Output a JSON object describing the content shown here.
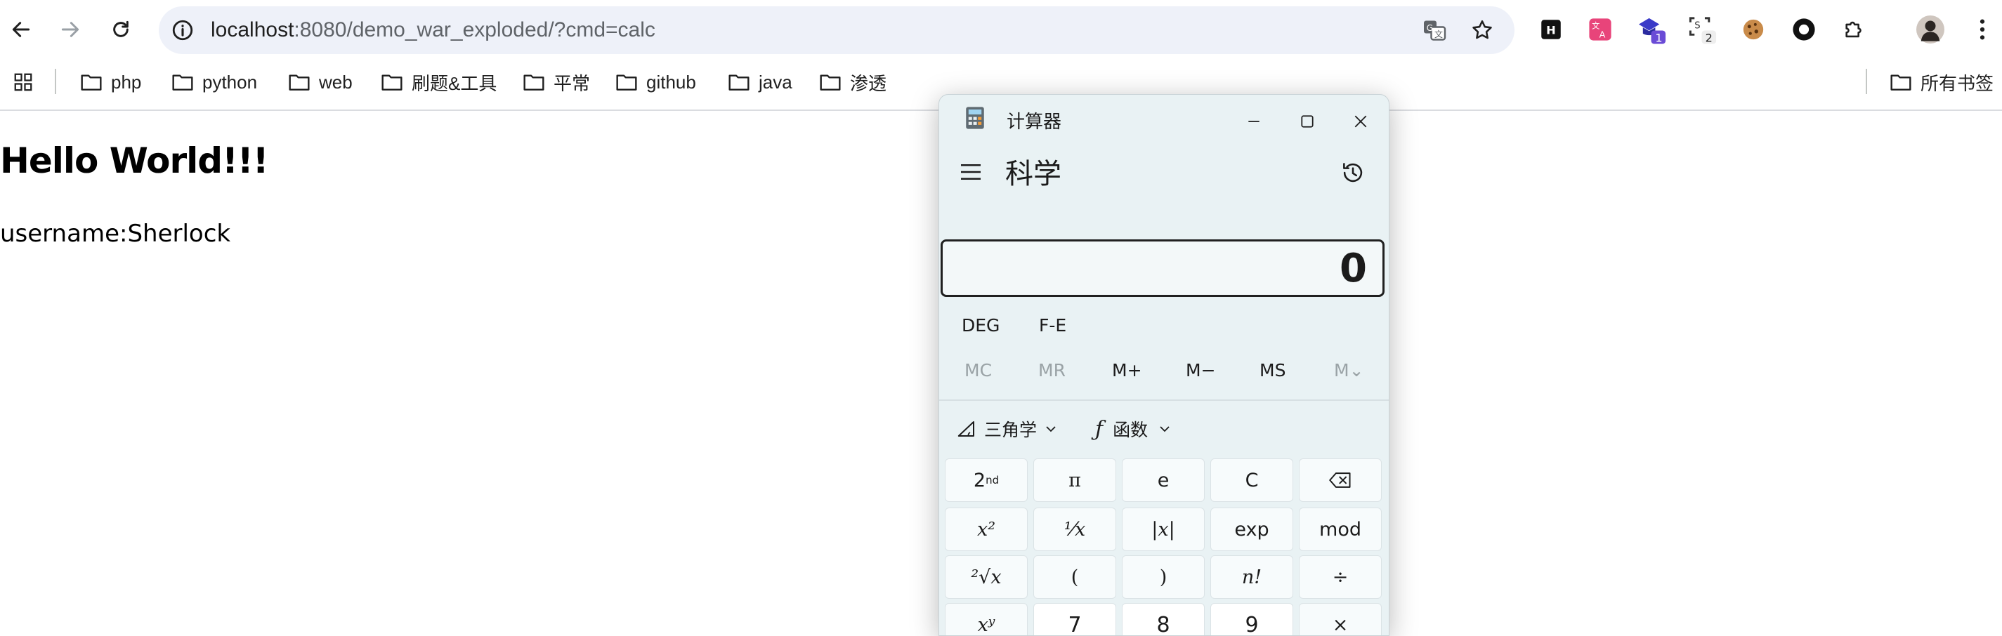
{
  "browser": {
    "url_host": "localhost",
    "url_rest": ":8080/demo_war_exploded/?cmd=calc",
    "extensions": [
      {
        "icon": "hackbar-icon",
        "badge": ""
      },
      {
        "icon": "translate-extension-icon",
        "badge": ""
      },
      {
        "icon": "extension-badge-icon",
        "badge": "1"
      },
      {
        "icon": "screenshot-extension-icon",
        "badge": "2"
      },
      {
        "icon": "cookie-icon",
        "badge": ""
      },
      {
        "icon": "circle-extension-icon",
        "badge": ""
      },
      {
        "icon": "puzzle-icon",
        "badge": ""
      }
    ],
    "bookmarks": [
      "php",
      "python",
      "web",
      "刷题&工具",
      "平常",
      "github",
      "java",
      "渗透"
    ],
    "all_bookmarks_label": "所有书签"
  },
  "page": {
    "heading": "Hello World!!!",
    "text": "username:Sherlock"
  },
  "calculator": {
    "title": "计算器",
    "mode": "科学",
    "display_value": "0",
    "angle_unit": "DEG",
    "fe_label": "F-E",
    "memory_buttons": [
      "MC",
      "MR",
      "M+",
      "M−",
      "MS",
      "M⌄"
    ],
    "trig_label": "三角学",
    "func_label": "函数",
    "keys": {
      "row1": [
        "2nd",
        "π",
        "e",
        "C",
        "⌫"
      ],
      "row2": [
        "x²",
        "¹⁄x",
        "|x|",
        "exp",
        "mod"
      ],
      "row3": [
        "²√x",
        "(",
        ")",
        "n!",
        "÷"
      ],
      "row4": [
        "xʸ",
        "7",
        "8",
        "9",
        "×"
      ]
    }
  }
}
